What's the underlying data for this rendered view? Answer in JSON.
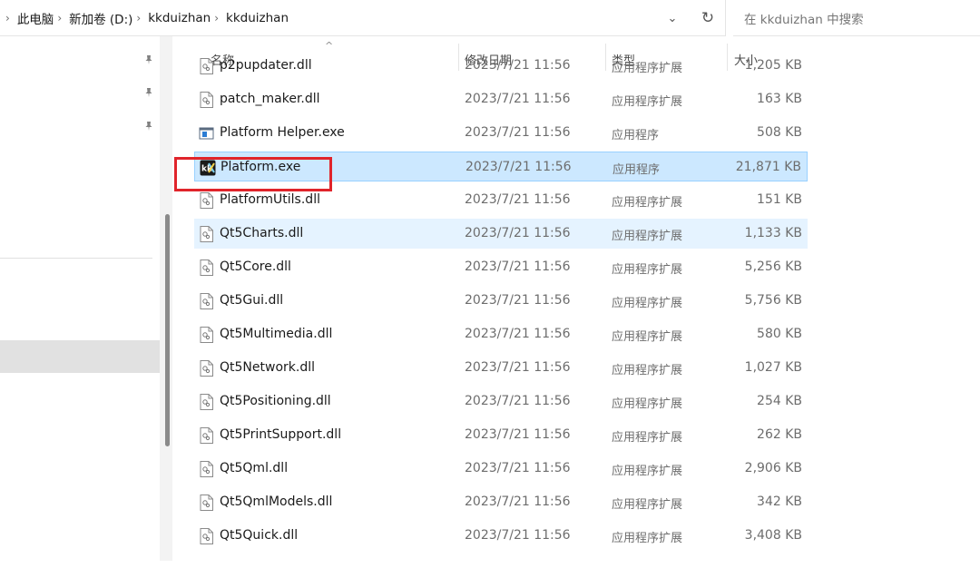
{
  "address_bar": {
    "breadcrumbs": [
      "此电脑",
      "新加卷 (D:)",
      "kkduizhan",
      "kkduizhan"
    ],
    "separator": "›",
    "dropdown_glyph": "⌄",
    "refresh_glyph": "↻"
  },
  "search": {
    "placeholder": "在 kkduizhan 中搜索"
  },
  "nav": {
    "pin_glyph": "📌"
  },
  "columns": {
    "name": "名称",
    "date": "修改日期",
    "type": "类型",
    "size": "大小"
  },
  "sort_indicator": "^",
  "files": [
    {
      "name": "p2pupdater.dll",
      "date": "2023/7/21 11:56",
      "type": "应用程序扩展",
      "size": "1,205 KB",
      "icon": "dll-icon"
    },
    {
      "name": "patch_maker.dll",
      "date": "2023/7/21 11:56",
      "type": "应用程序扩展",
      "size": "163 KB",
      "icon": "dll-icon"
    },
    {
      "name": "Platform Helper.exe",
      "date": "2023/7/21 11:56",
      "type": "应用程序",
      "size": "508 KB",
      "icon": "exe-window-icon"
    },
    {
      "name": "Platform.exe",
      "date": "2023/7/21 11:56",
      "type": "应用程序",
      "size": "21,871 KB",
      "icon": "kk-app-icon"
    },
    {
      "name": "PlatformUtils.dll",
      "date": "2023/7/21 11:56",
      "type": "应用程序扩展",
      "size": "151 KB",
      "icon": "dll-icon"
    },
    {
      "name": "Qt5Charts.dll",
      "date": "2023/7/21 11:56",
      "type": "应用程序扩展",
      "size": "1,133 KB",
      "icon": "dll-icon"
    },
    {
      "name": "Qt5Core.dll",
      "date": "2023/7/21 11:56",
      "type": "应用程序扩展",
      "size": "5,256 KB",
      "icon": "dll-icon"
    },
    {
      "name": "Qt5Gui.dll",
      "date": "2023/7/21 11:56",
      "type": "应用程序扩展",
      "size": "5,756 KB",
      "icon": "dll-icon"
    },
    {
      "name": "Qt5Multimedia.dll",
      "date": "2023/7/21 11:56",
      "type": "应用程序扩展",
      "size": "580 KB",
      "icon": "dll-icon"
    },
    {
      "name": "Qt5Network.dll",
      "date": "2023/7/21 11:56",
      "type": "应用程序扩展",
      "size": "1,027 KB",
      "icon": "dll-icon"
    },
    {
      "name": "Qt5Positioning.dll",
      "date": "2023/7/21 11:56",
      "type": "应用程序扩展",
      "size": "254 KB",
      "icon": "dll-icon"
    },
    {
      "name": "Qt5PrintSupport.dll",
      "date": "2023/7/21 11:56",
      "type": "应用程序扩展",
      "size": "262 KB",
      "icon": "dll-icon"
    },
    {
      "name": "Qt5Qml.dll",
      "date": "2023/7/21 11:56",
      "type": "应用程序扩展",
      "size": "2,906 KB",
      "icon": "dll-icon"
    },
    {
      "name": "Qt5QmlModels.dll",
      "date": "2023/7/21 11:56",
      "type": "应用程序扩展",
      "size": "342 KB",
      "icon": "dll-icon"
    },
    {
      "name": "Qt5Quick.dll",
      "date": "2023/7/21 11:56",
      "type": "应用程序扩展",
      "size": "3,408 KB",
      "icon": "dll-icon"
    }
  ],
  "selected_file": "Platform.exe",
  "hover_file": "Qt5Charts.dll",
  "colors": {
    "selection": "#cce8ff",
    "hover": "#e5f3ff",
    "highlight_box": "#e0242b"
  }
}
